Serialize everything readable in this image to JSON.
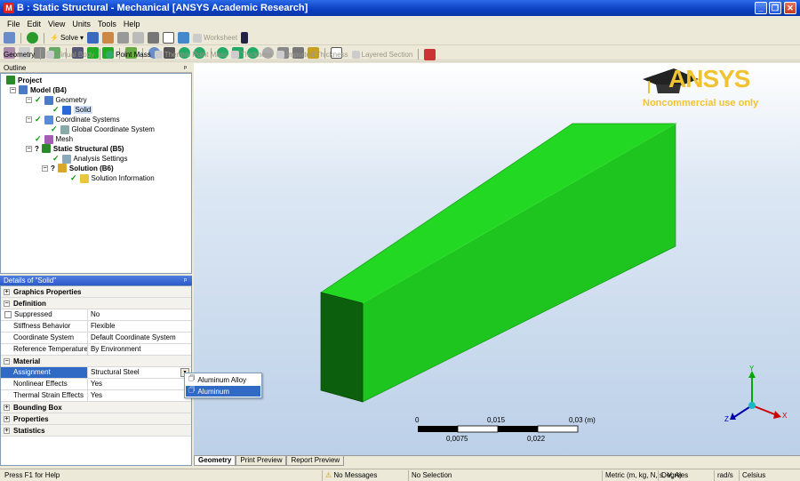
{
  "window": {
    "title": "B : Static Structural - Mechanical [ANSYS Academic Research]",
    "app_letter": "M"
  },
  "menu": [
    "File",
    "Edit",
    "View",
    "Units",
    "Tools",
    "Help"
  ],
  "toolbar1": {
    "solve_label": "Solve",
    "worksheet_label": "Worksheet"
  },
  "toolbar3": {
    "geometry": "Geometry",
    "virtual_body": "Virtual Body",
    "point_mass": "Point Mass",
    "thermal_point_mass": "Thermal Point Mass",
    "thickness": "Thickness",
    "imported_thickness": "Imported Thickness",
    "layered_section": "Layered Section"
  },
  "outline": {
    "title": "Outline",
    "nodes": [
      {
        "label": "Project",
        "bold": true
      },
      {
        "label": "Model (B4)",
        "bold": true
      },
      {
        "label": "Geometry",
        "bold": false
      },
      {
        "label": "Solid",
        "bold": false
      },
      {
        "label": "Coordinate Systems",
        "bold": false
      },
      {
        "label": "Global Coordinate System",
        "bold": false
      },
      {
        "label": "Mesh",
        "bold": false
      },
      {
        "label": "Static Structural (B5)",
        "bold": true
      },
      {
        "label": "Analysis Settings",
        "bold": false
      },
      {
        "label": "Solution (B6)",
        "bold": true
      },
      {
        "label": "Solution Information",
        "bold": false
      }
    ]
  },
  "details": {
    "title": "Details of \"Solid\"",
    "groups": {
      "graphics": "Graphics Properties",
      "definition": "Definition",
      "material": "Material",
      "bounding_box": "Bounding Box",
      "properties": "Properties",
      "statistics": "Statistics"
    },
    "rows": {
      "suppressed": {
        "k": "Suppressed",
        "v": "No"
      },
      "stiffness": {
        "k": "Stiffness Behavior",
        "v": "Flexible"
      },
      "coord": {
        "k": "Coordinate System",
        "v": "Default Coordinate System"
      },
      "reftemp": {
        "k": "Reference Temperature",
        "v": "By Environment"
      },
      "assignment": {
        "k": "Assignment",
        "v": "Structural Steel"
      },
      "nonlinear": {
        "k": "Nonlinear Effects",
        "v": "Yes"
      },
      "thermal": {
        "k": "Thermal Strain Effects",
        "v": "Yes"
      }
    }
  },
  "dropdown": {
    "options": [
      "Aluminum Alloy",
      "Aluminum"
    ],
    "highlighted": "Aluminum"
  },
  "logo": {
    "brand": "ANSYS",
    "subtitle": "Noncommercial use only"
  },
  "scale": {
    "labels_top": [
      "0",
      "0,015",
      "0,03 (m)"
    ],
    "labels_bottom": [
      "0,0075",
      "0,022"
    ]
  },
  "triad": {
    "x": "X",
    "y": "Y",
    "z": "Z"
  },
  "view_tabs": [
    "Geometry",
    "Print Preview",
    "Report Preview"
  ],
  "status": {
    "help": "Press F1 for Help",
    "messages": "No Messages",
    "selection": "No Selection",
    "units": "Metric (m, kg, N, s, V, A)",
    "angle": "Degrees",
    "rate": "rad/s",
    "temp": "Celsius"
  },
  "colors": {
    "body": "#1fd11f",
    "body_dark": "#0c5f0c",
    "body_side": "#18c318",
    "logo": "#f1c232",
    "selection": "#316ac5"
  }
}
